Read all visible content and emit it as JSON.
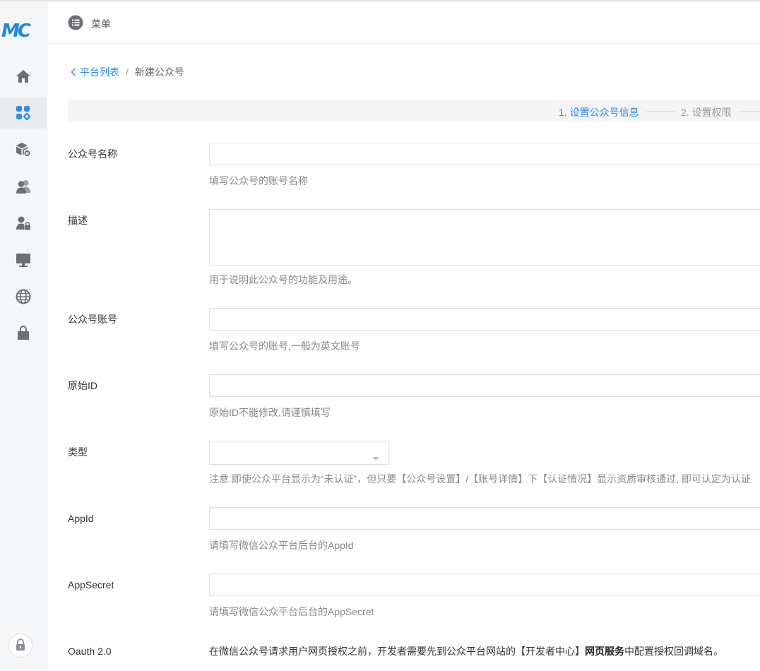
{
  "app": {
    "logo_text": "MC",
    "brand_color": "#1e88e5"
  },
  "sidebar": {
    "items": [
      {
        "icon": "home-icon",
        "active": false
      },
      {
        "icon": "apps-settings-icon",
        "active": true
      },
      {
        "icon": "box-settings-icon",
        "active": false
      },
      {
        "icon": "users-icon",
        "active": false
      },
      {
        "icon": "user-lock-icon",
        "active": false
      },
      {
        "icon": "monitor-icon",
        "active": false
      },
      {
        "icon": "globe-icon",
        "active": false
      },
      {
        "icon": "bag-icon",
        "active": false
      }
    ],
    "bottom_icon": "lock-icon"
  },
  "header": {
    "menu_label": "菜单",
    "menu_icon": "list-icon"
  },
  "breadcrumb": {
    "back_label": "平台列表",
    "separator": "/",
    "current": "新建公众号"
  },
  "steps": {
    "items": [
      {
        "label": "1. 设置公众号信息",
        "active": true
      },
      {
        "label": "2. 设置权限",
        "active": false
      }
    ],
    "active_color": "#2d8cf0"
  },
  "form": {
    "name": {
      "label": "公众号名称",
      "value": "",
      "hint": "填写公众号的账号名称"
    },
    "description": {
      "label": "描述",
      "value": "",
      "hint": "用于说明此公众号的功能及用途。"
    },
    "account": {
      "label": "公众号账号",
      "value": "",
      "hint": "填写公众号的账号,一般为英文账号"
    },
    "original_id": {
      "label": "原始ID",
      "value": "",
      "hint": "原始ID不能修改,请谨慎填写"
    },
    "type": {
      "label": "类型",
      "value": "",
      "hint": "注意:即使公众平台显示为“未认证”，但只要【公众号设置】/【账号详情】下【认证情况】显示资质审核通过, 即可认定为认证"
    },
    "appid": {
      "label": "AppId",
      "value": "",
      "hint": "请填写微信公众平台后台的AppId"
    },
    "appsecret": {
      "label": "AppSecret",
      "value": "",
      "hint": "请填写微信公众平台后台的AppSecret"
    },
    "oauth": {
      "label": "Oauth 2.0",
      "text_before": "在微信公众号请求用户网页授权之前，开发者需要先到公众平台网站的【开发者中心】",
      "text_bold": "网页服务",
      "text_after": "中配置授权回调域名。"
    }
  }
}
